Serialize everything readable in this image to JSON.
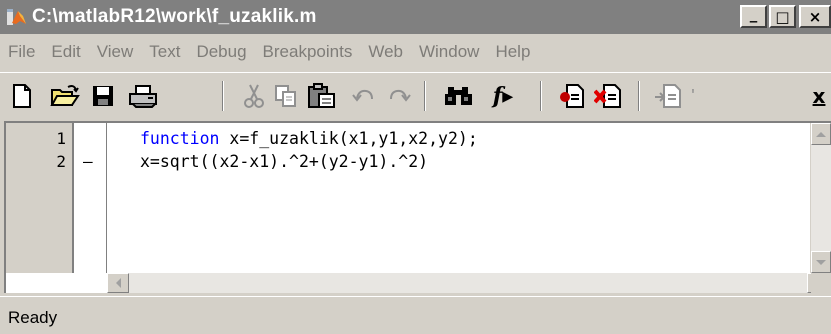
{
  "window": {
    "title": "C:\\matlabR12\\work\\f_uzaklik.m",
    "controls": {
      "minimize": "_",
      "maximize": "□",
      "close": "×"
    }
  },
  "menu": {
    "items": [
      "File",
      "Edit",
      "View",
      "Text",
      "Debug",
      "Breakpoints",
      "Web",
      "Window",
      "Help"
    ]
  },
  "toolbar": {
    "buttons": [
      {
        "icon": "new-file-icon"
      },
      {
        "icon": "open-folder-icon"
      },
      {
        "icon": "save-icon"
      },
      {
        "icon": "print-icon"
      },
      {
        "icon": "cut-icon"
      },
      {
        "icon": "copy-icon"
      },
      {
        "icon": "paste-icon"
      },
      {
        "icon": "undo-icon"
      },
      {
        "icon": "redo-icon"
      },
      {
        "icon": "find-icon"
      },
      {
        "icon": "function-icon",
        "label": "f▸"
      },
      {
        "icon": "set-breakpoint-icon"
      },
      {
        "icon": "clear-breakpoint-icon"
      },
      {
        "icon": "step-in-icon"
      },
      {
        "icon": "close-icon",
        "label": "x"
      }
    ]
  },
  "editor": {
    "lines": [
      {
        "number": "1",
        "marker": "",
        "keyword": "function",
        "text": " x=f_uzaklik(x1,y1,x2,y2);"
      },
      {
        "number": "2",
        "marker": "–",
        "keyword": "",
        "text": "x=sqrt((x2-x1).^2+(y2-y1).^2)"
      }
    ]
  },
  "status": {
    "text": "Ready"
  },
  "colors": {
    "keyword": "#0000ff",
    "titlebar": "#808080",
    "chrome": "#d4d0c8",
    "menu_text": "#7e7c78"
  }
}
